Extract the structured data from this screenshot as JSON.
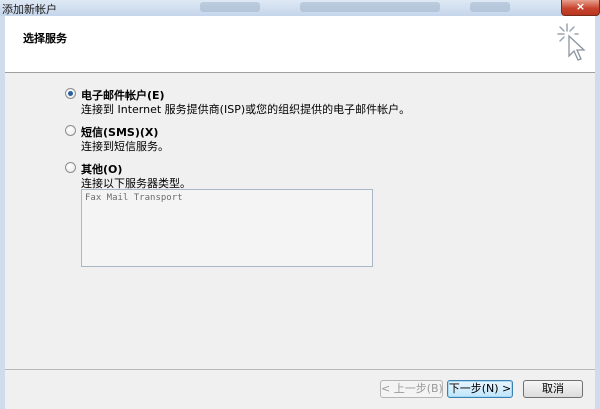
{
  "window": {
    "title": "添加新帐户",
    "close_glyph": "×"
  },
  "header": {
    "title": "选择服务",
    "icon": "wizard-sparkle-cursor-icon"
  },
  "options": [
    {
      "label": "电子邮件帐户(E)",
      "description": "连接到 Internet 服务提供商(ISP)或您的组织提供的电子邮件帐户。",
      "checked": true
    },
    {
      "label": "短信(SMS)(X)",
      "description": "连接到短信服务。",
      "checked": false
    },
    {
      "label": "其他(O)",
      "description": "连接以下服务器类型。",
      "checked": false
    }
  ],
  "server_types": [
    "Fax Mail Transport"
  ],
  "buttons": {
    "back": "< 上一步(B)",
    "next": "下一步(N) >",
    "cancel": "取消"
  }
}
